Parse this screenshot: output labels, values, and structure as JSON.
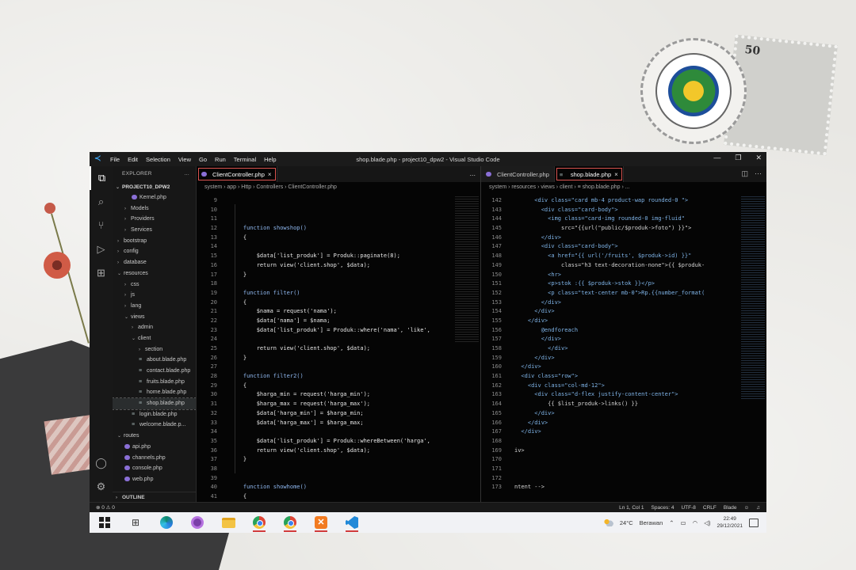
{
  "decor": {
    "postage_value": "50"
  },
  "window": {
    "title": "shop.blade.php - project10_dpw2 - Visual Studio Code",
    "menu": [
      "File",
      "Edit",
      "Selection",
      "View",
      "Go",
      "Run",
      "Terminal",
      "Help"
    ]
  },
  "explorer": {
    "header": "EXPLORER",
    "more": "...",
    "project": "PROJECT10_DPW2",
    "items": [
      {
        "label": "Kernel.php",
        "indent": 2,
        "kind": "php"
      },
      {
        "label": "Models",
        "indent": 1,
        "kind": "folder-closed"
      },
      {
        "label": "Providers",
        "indent": 1,
        "kind": "folder-closed"
      },
      {
        "label": "Services",
        "indent": 1,
        "kind": "folder-closed"
      },
      {
        "label": "bootstrap",
        "indent": 0,
        "kind": "folder-closed"
      },
      {
        "label": "config",
        "indent": 0,
        "kind": "folder-closed"
      },
      {
        "label": "database",
        "indent": 0,
        "kind": "folder-closed"
      },
      {
        "label": "resources",
        "indent": 0,
        "kind": "folder-open"
      },
      {
        "label": "css",
        "indent": 1,
        "kind": "folder-closed"
      },
      {
        "label": "js",
        "indent": 1,
        "kind": "folder-closed"
      },
      {
        "label": "lang",
        "indent": 1,
        "kind": "folder-closed"
      },
      {
        "label": "views",
        "indent": 1,
        "kind": "folder-open"
      },
      {
        "label": "admin",
        "indent": 2,
        "kind": "folder-closed"
      },
      {
        "label": "client",
        "indent": 2,
        "kind": "folder-open"
      },
      {
        "label": "section",
        "indent": 3,
        "kind": "folder-closed"
      },
      {
        "label": "about.blade.php",
        "indent": 3,
        "kind": "blade"
      },
      {
        "label": "contact.blade.php",
        "indent": 3,
        "kind": "blade"
      },
      {
        "label": "fruits.blade.php",
        "indent": 3,
        "kind": "blade"
      },
      {
        "label": "home.blade.php",
        "indent": 3,
        "kind": "blade"
      },
      {
        "label": "shop.blade.php",
        "indent": 3,
        "kind": "blade",
        "selected": true
      },
      {
        "label": "login.blade.php",
        "indent": 2,
        "kind": "blade"
      },
      {
        "label": "welcome.blade.p...",
        "indent": 2,
        "kind": "blade"
      },
      {
        "label": "routes",
        "indent": 0,
        "kind": "folder-open"
      },
      {
        "label": "api.php",
        "indent": 1,
        "kind": "php"
      },
      {
        "label": "channels.php",
        "indent": 1,
        "kind": "php"
      },
      {
        "label": "console.php",
        "indent": 1,
        "kind": "php"
      },
      {
        "label": "web.php",
        "indent": 1,
        "kind": "php"
      }
    ],
    "outline": "OUTLINE"
  },
  "left_editor": {
    "tab": "ClientController.php",
    "tab_close": "×",
    "tab_more": "...",
    "breadcrumb": "system › app › Http › Controllers › ClientController.php",
    "lines": [
      {
        "n": "9",
        "t": ""
      },
      {
        "n": "10",
        "t": ""
      },
      {
        "n": "11",
        "t": ""
      },
      {
        "n": "12",
        "t": "    function showshop()"
      },
      {
        "n": "13",
        "t": "    {"
      },
      {
        "n": "14",
        "t": ""
      },
      {
        "n": "15",
        "t": "        $data['list_produk'] = Produk::paginate(8);"
      },
      {
        "n": "16",
        "t": "        return view('client.shop', $data);"
      },
      {
        "n": "17",
        "t": "    }"
      },
      {
        "n": "18",
        "t": ""
      },
      {
        "n": "19",
        "t": "    function filter()"
      },
      {
        "n": "20",
        "t": "    {"
      },
      {
        "n": "21",
        "t": "        $nama = request('nama');"
      },
      {
        "n": "22",
        "t": "        $data['nama'] = $nama;"
      },
      {
        "n": "23",
        "t": "        $data['list_produk'] = Produk::where('nama', 'like',"
      },
      {
        "n": "24",
        "t": ""
      },
      {
        "n": "25",
        "t": "        return view('client.shop', $data);"
      },
      {
        "n": "26",
        "t": "    }"
      },
      {
        "n": "27",
        "t": ""
      },
      {
        "n": "28",
        "t": "    function filter2()"
      },
      {
        "n": "29",
        "t": "    {"
      },
      {
        "n": "30",
        "t": "        $harga_min = request('harga_min');"
      },
      {
        "n": "31",
        "t": "        $harga_max = request('harga_max');"
      },
      {
        "n": "32",
        "t": "        $data['harga_min'] = $harga_min;"
      },
      {
        "n": "33",
        "t": "        $data['harga_max'] = $harga_max;"
      },
      {
        "n": "34",
        "t": ""
      },
      {
        "n": "35",
        "t": "        $data['list_produk'] = Produk::whereBetween('harga',"
      },
      {
        "n": "36",
        "t": "        return view('client.shop', $data);"
      },
      {
        "n": "37",
        "t": "    }"
      },
      {
        "n": "38",
        "t": ""
      },
      {
        "n": "39",
        "t": ""
      },
      {
        "n": "40",
        "t": "    function showhome()"
      },
      {
        "n": "41",
        "t": "    {"
      }
    ]
  },
  "right_editor": {
    "tab_inactive": "ClientController.php",
    "tab_active": "shop.blade.php",
    "tab_close": "×",
    "breadcrumb": "system › resources › views › client › ≡ shop.blade.php › ...",
    "lines": [
      {
        "n": "142",
        "t": "      <div class=\"card mb-4 product-wap rounded-0 \">"
      },
      {
        "n": "143",
        "t": "        <div class=\"card-body\">"
      },
      {
        "n": "144",
        "t": "          <img class=\"card-img rounded-0 img-fluid\""
      },
      {
        "n": "145",
        "t": "              src=\"{{url(\"public/$produk->foto\") }}\">"
      },
      {
        "n": "146",
        "t": "        </div>"
      },
      {
        "n": "147",
        "t": "        <div class=\"card-body\">"
      },
      {
        "n": "148",
        "t": "          <a href=\"{{ url('/fruits', $produk->id) }}\""
      },
      {
        "n": "149",
        "t": "              class=\"h3 text-decoration-none\">{{ $produk-"
      },
      {
        "n": "150",
        "t": "          <hr>"
      },
      {
        "n": "151",
        "t": "          <p>stok :{{ $produk->stok }}</p>"
      },
      {
        "n": "152",
        "t": "          <p class=\"text-center mb-0\">Rp.{{number_format("
      },
      {
        "n": "153",
        "t": "        </div>"
      },
      {
        "n": "154",
        "t": "      </div>"
      },
      {
        "n": "155",
        "t": "    </div>"
      },
      {
        "n": "156",
        "t": "        @endforeach"
      },
      {
        "n": "157",
        "t": "        </div>"
      },
      {
        "n": "158",
        "t": "          </div>"
      },
      {
        "n": "159",
        "t": "      </div>"
      },
      {
        "n": "160",
        "t": "  </div>"
      },
      {
        "n": "161",
        "t": "  <div class=\"row\">"
      },
      {
        "n": "162",
        "t": "    <div class=\"col-md-12\">"
      },
      {
        "n": "163",
        "t": "      <div class=\"d-flex justify-content-center\">"
      },
      {
        "n": "164",
        "t": "          {{ $list_produk->links() }}"
      },
      {
        "n": "165",
        "t": "      </div>"
      },
      {
        "n": "166",
        "t": "    </div>"
      },
      {
        "n": "167",
        "t": "  </div>"
      },
      {
        "n": "168",
        "t": ""
      },
      {
        "n": "169",
        "t": "iv>"
      },
      {
        "n": "170",
        "t": ""
      },
      {
        "n": "171",
        "t": ""
      },
      {
        "n": "172",
        "t": ""
      },
      {
        "n": "173",
        "t": "ntent -->"
      }
    ]
  },
  "status": {
    "problems": "⊗ 0 ⚠ 0",
    "position": "Ln 1, Col 1",
    "spaces": "Spaces: 4",
    "encoding": "UTF-8",
    "eol": "CRLF",
    "language": "Blade"
  },
  "taskbar": {
    "temperature": "24°C",
    "weather": "Berawan",
    "time": "22:49",
    "date": "29/12/2021"
  }
}
